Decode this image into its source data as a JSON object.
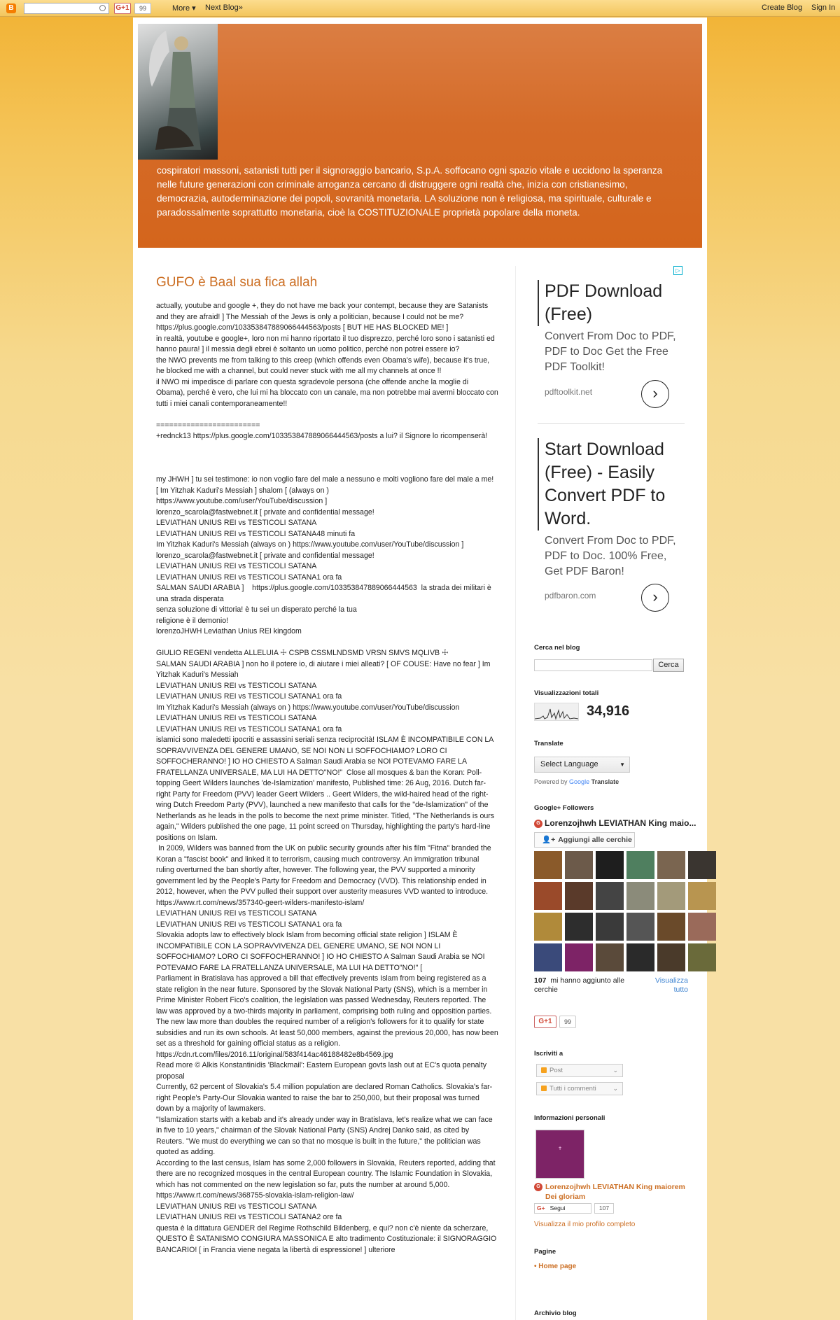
{
  "navbar": {
    "search_placeholder": "",
    "gplus_label": "G+1",
    "gplus_count": "99",
    "more_label": "More ▾",
    "next_blog_label": "Next Blog»",
    "create_blog_label": "Create Blog",
    "sign_in_label": "Sign In"
  },
  "header": {
    "description": "cospiratori massoni, satanisti tutti per il signoraggio bancario, S.p.A. soffocano ogni spazio vitale e uccidono la speranza nelle future generazioni con criminale arroganza cercano di distruggere ogni realtà che, inizia con cristianesimo, democrazia, autoderminazione dei popoli, sovranità monetaria. LA soluzione non è religiosa, ma spirituale, culturale e paradossalmente soprattutto monetaria, cioè la COSTITUZIONALE proprietà popolare della moneta."
  },
  "post": {
    "title": "GUFO è Baal sua fica allah",
    "paragraphs": [
      "actually, youtube and google +, they do not have me back your contempt, because they are Satanists and they are afraid! ] The Messiah of the Jews is only a politician, because I could not be me?\nhttps://plus.google.com/103353847889066444563/posts [ BUT HE HAS BLOCKED ME! ]\nin realtà, youtube e google+, loro non mi hanno riportato il tuo disprezzo, perché loro sono i satanisti ed hanno paura! ] il messia degli ebrei è soltanto un uomo politico, perché non potrei essere io?\nthe NWO prevents me from talking to this creep (which offends even Obama's wife), because it's true, he blocked me with a channel, but could never stuck with me all my channels at once !!\nil NWO mi impedisce di parlare con questa sgradevole persona (che offende anche la moglie di Obama), perché è vero, che lui mi ha bloccato con un canale, ma non potrebbe mai avermi bloccato con tutti i miei canali contemporaneamente!!\n\n========================\n+rednck13 https://plus.google.com/103353847889066444563/posts a lui? il Signore lo ricompenserà!\n\n\n\nmy JHWH ] tu sei testimone: io non voglio fare del male a nessuno e molti vogliono fare del male a me!  [ Im Yitzhak Kaduri's Messiah ] shalom [ (always on )\nhttps://www.youtube.com/user/YouTube/discussion ]\nlorenzo_scarola@fastwebnet.it [ private and confidential message!\nLEVIATHAN UNIUS REI vs TESTICOLI SATANA\nLEVIATHAN UNIUS REI vs TESTICOLI SATANA48 minuti fa\nIm Yitzhak Kaduri's Messiah (always on ) https://www.youtube.com/user/YouTube/discussion ]\nlorenzo_scarola@fastwebnet.it [ private and confidential message!\nLEVIATHAN UNIUS REI vs TESTICOLI SATANA\nLEVIATHAN UNIUS REI vs TESTICOLI SATANA1 ora fa\nSALMAN SAUDI ARABIA ]    https://plus.google.com/103353847889066444563  la strada dei militari è una strada disperata\nsenza soluzione di vittoria! è tu sei un disperato perché la tua\nreligione è il demonio!\nlorenzoJHWH Leviathan Unius REI kingdom\n\nGIULIO REGENI vendetta ALLELUIA ☩ CSPB CSSMLNDSMD VRSN SMVS MQLIVB ☩\nSALMAN SAUDI ARABIA ] non ho il potere io, di aiutare i miei alleati? [ OF COUSE: Have no fear ] Im Yitzhak Kaduri's Messiah\nLEVIATHAN UNIUS REI vs TESTICOLI SATANA\nLEVIATHAN UNIUS REI vs TESTICOLI SATANA1 ora fa\nIm Yitzhak Kaduri's Messiah (always on ) https://www.youtube.com/user/YouTube/discussion\nLEVIATHAN UNIUS REI vs TESTICOLI SATANA\nLEVIATHAN UNIUS REI vs TESTICOLI SATANA1 ora fa\nislamici sono maledetti ipocriti e assassini seriali senza reciprocità! ISLAM È INCOMPATIBILE CON LA SOPRAVVIVENZA DEL GENERE UMANO, SE NOI NON LI SOFFOCHIAMO? LORO CI SOFFOCHERANNO! ] IO HO CHIESTO A Salman Saudi Arabia se NOI POTEVAMO FARE LA FRATELLANZA UNIVERSALE, MA LUI HA DETTO\"NO!\"  Close all mosques & ban the Koran: Poll-topping Geert Wilders launches 'de-Islamization' manifesto, Published time: 26 Aug, 2016. Dutch far-right Party for Freedom (PVV) leader Geert Wilders .. Geert Wilders, the wild-haired head of the right-wing Dutch Freedom Party (PVV), launched a new manifesto that calls for the \"de-Islamization\" of the Netherlands as he leads in the polls to become the next prime minister. Titled, \"The Netherlands is ours again,\" Wilders published the one page, 11 point screed on Thursday, highlighting the party's hard-line positions on Islam.\n In 2009, Wilders was banned from the UK on public security grounds after his film \"Fitna\" branded the Koran a \"fascist book\" and linked it to terrorism, causing much controversy. An immigration tribunal ruling overturned the ban shortly after, however. The following year, the PVV supported a minority government led by the People's Party for Freedom and Democracy (VVD). This relationship ended in 2012, however, when the PVV pulled their support over austerity measures VVD wanted to introduce. https://www.rt.com/news/357340-geert-wilders-manifesto-islam/\nLEVIATHAN UNIUS REI vs TESTICOLI SATANA\nLEVIATHAN UNIUS REI vs TESTICOLI SATANA1 ora fa\nSlovakia adopts law to effectively block Islam from becoming official state religion ] ISLAM È INCOMPATIBILE CON LA SOPRAVVIVENZA DEL GENERE UMANO, SE NOI NON LI SOFFOCHIAMO? LORO CI SOFFOCHERANNO! ] IO HO CHIESTO A Salman Saudi Arabia se NOI POTEVAMO FARE LA FRATELLANZA UNIVERSALE, MA LUI HA DETTO\"NO!\" [\nParliament in Bratislava has approved a bill that effectively prevents Islam from being registered as a state religion in the near future. Sponsored by the Slovak National Party (SNS), which is a member in Prime Minister Robert Fico's coalition, the legislation was passed Wednesday, Reuters reported. The law was approved by a two-thirds majority in parliament, comprising both ruling and opposition parties.\nThe new law more than doubles the required number of a religion's followers for it to qualify for state subsidies and run its own schools. At least 50,000 members, against the previous 20,000, has now been set as a threshold for gaining official status as a religion.\nhttps://cdn.rt.com/files/2016.11/original/583f414ac46188482e8b4569.jpg\nRead more © Alkis Konstantinidis 'Blackmail': Eastern European govts lash out at EC's quota penalty proposal\nCurrently, 62 percent of Slovakia's 5.4 million population are declared Roman Catholics. Slovakia's far-right People's Party-Our Slovakia wanted to raise the bar to 250,000, but their proposal was turned down by a majority of lawmakers.\n\"Islamization starts with a kebab and it's already under way in Bratislava, let's realize what we can face in five to 10 years,\" chairman of the Slovak National Party (SNS) Andrej Danko said, as cited by Reuters. \"We must do everything we can so that no mosque is built in the future,\" the politician was quoted as adding.\nAccording to the last census, Islam has some 2,000 followers in Slovakia, Reuters reported, adding that there are no recognized mosques in the central European country. The Islamic Foundation in Slovakia, which has not commented on the new legislation so far, puts the number at around 5,000.\nhttps://www.rt.com/news/368755-slovakia-islam-religion-law/\nLEVIATHAN UNIUS REI vs TESTICOLI SATANA\nLEVIATHAN UNIUS REI vs TESTICOLI SATANA2 ore fa\nquesta è la dittatura GENDER del Regime Rothschild Bildenberg, e qui? non c'è niente da scherzare, QUESTO È SATANISMO CONGIURA MASSONICA E alto tradimento Costituzionale: il SIGNORAGGIO BANCARIO! [ in Francia viene negata la libertà di espressione! ] ulteriore"
    ]
  },
  "sidebar": {
    "ad1": {
      "title": "PDF Download (Free)",
      "desc": "Convert From Doc to PDF, PDF to Doc Get the Free PDF Toolkit!",
      "domain": "pdftoolkit.net"
    },
    "ad2": {
      "title": "Start Download (Free) - Easily Convert PDF to Word.",
      "desc": "Convert From Doc to PDF, PDF to Doc. 100% Free, Get PDF Baron!",
      "domain": "pdfbaron.com"
    },
    "search": {
      "title": "Cerca nel blog",
      "button": "Cerca"
    },
    "stats": {
      "title": "Visualizzazioni totali",
      "value": "34,916"
    },
    "translate": {
      "title": "Translate",
      "select": "Select Language",
      "powered_prefix": "Powered by",
      "google": "Google",
      "translate": "Translate"
    },
    "followers": {
      "title": "Google+ Followers",
      "name": "Lorenzojhwh LEVIATHAN King maio...",
      "add_button": "Aggiungi alle cerchie",
      "count": "107",
      "count_text": "mi hanno aggiunto alle cerchie",
      "view_all": "Visualizza tutto"
    },
    "gplus": {
      "label": "G+1",
      "count": "99"
    },
    "subscribe": {
      "title": "Iscriviti a",
      "posts": "Post",
      "comments": "Tutti i commenti"
    },
    "profile": {
      "title": "Informazioni personali",
      "name": "Lorenzojhwh LEVIATHAN King maiorem Dei gloriam",
      "follow": "Segui",
      "follow_count": "107",
      "full_profile": "Visualizza il mio profilo completo"
    },
    "pages": {
      "title": "Pagine",
      "home": "Home page"
    },
    "archive": {
      "title": "Archivio blog"
    }
  },
  "colors": {
    "accent": "#cc6f24",
    "header_bg": "#d56b28",
    "page_bg": "#f8e0a5"
  }
}
